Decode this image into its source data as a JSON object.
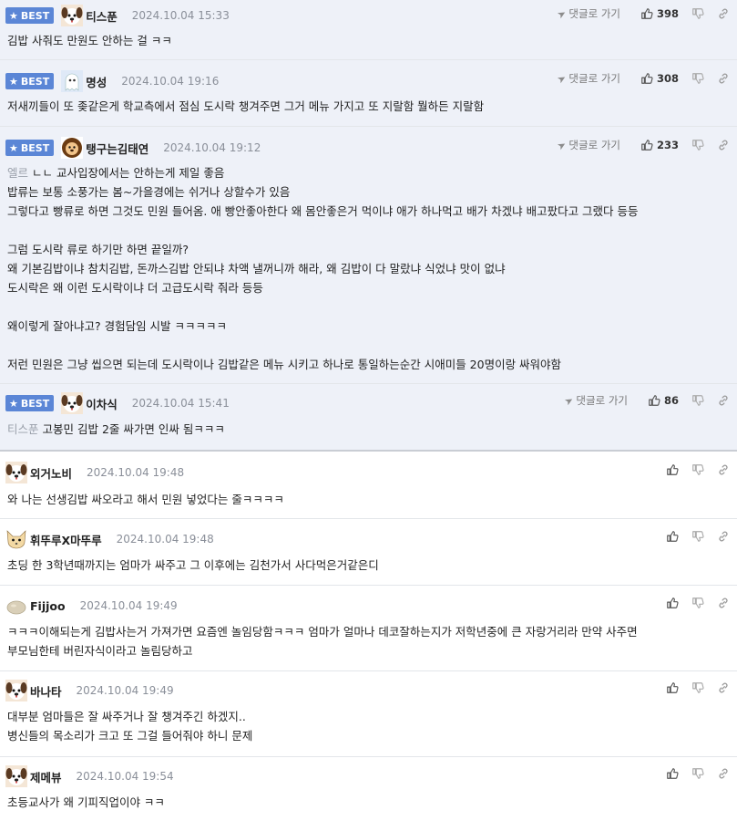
{
  "best_label": "BEST",
  "reply_label": "댓글로 가기",
  "comments": [
    {
      "nick": "티스푼",
      "date": "2024.10.04 15:33",
      "likes": "398",
      "mention": "",
      "text": "김밥 사줘도 만원도 안하는 걸 ㅋㅋ",
      "avatar": "dog-avatar"
    },
    {
      "nick": "명성",
      "date": "2024.10.04 19:16",
      "likes": "308",
      "mention": "",
      "text": "저새끼들이 또 좆같은게 학교측에서 점심 도시락 챙겨주면 그거 메뉴 가지고 또 지랄함 뭘하든 지랄함",
      "avatar": "ghost-avatar"
    },
    {
      "nick": "탱구는김태연",
      "date": "2024.10.04 19:12",
      "likes": "233",
      "mention": "엘르",
      "text": "ㄴㄴ 교사입장에서는 안하는게 제일 좋음\n밥류는 보통 소풍가는 봄~가을경에는 쉬거나 상할수가 있음\n그렇다고 빵류로 하면 그것도 민원 들어옴. 애 빵안좋아한다 왜 몸안좋은거 먹이냐 애가 하나먹고 배가 차겠냐 배고팠다고 그랬다 등등\n\n그럼 도시락 류로 하기만 하면 끝일까?\n왜 기본김밥이냐 참치김밥, 돈까스김밥 안되냐 차액 낼꺼니까 해라, 왜 김밥이 다 말랐냐 식었냐 맛이 없냐\n도시락은 왜 이런 도시락이냐 더 고급도시락 줘라 등등\n\n왜이렇게 잘아냐고? 경험담임 시발 ㅋㅋㅋㅋㅋ\n\n저런 민원은 그냥 씹으면 되는데 도시락이나 김밥같은 메뉴 시키고 하나로 통일하는순간 시애미들 20명이랑 싸워야함",
      "avatar": "lion-avatar"
    },
    {
      "nick": "이차식",
      "date": "2024.10.04 15:41",
      "likes": "86",
      "mention": "티스푼",
      "text": "고봉민 김밥 2줄 싸가면 인싸 됨ㅋㅋㅋ",
      "avatar": "dog-avatar"
    },
    {
      "nick": "외거노비",
      "date": "2024.10.04 19:48",
      "text": "와 나는 선생김밥 싸오라고 해서 민원 넣었다는 줄ㅋㅋㅋㅋ",
      "avatar": "dog-avatar"
    },
    {
      "nick": "휘뚜루X마뚜루",
      "date": "2024.10.04 19:48",
      "text": "초딩 한 3학년때까지는 엄마가 싸주고 그 이후에는 김천가서 사다먹은거같은디",
      "avatar": "cat-avatar"
    },
    {
      "nick": "Fijjoo",
      "date": "2024.10.04 19:49",
      "text": "ㅋㅋㅋ이해되는게 김밥사는거 가져가면 요즘엔 놀임당함ㅋㅋㅋ 엄마가 얼마나 데코잘하는지가 저학년중에 큰 자랑거리라 만약 사주면\n부모님한테 버린자식이라고 놀림당하고",
      "avatar": "stone-avatar"
    },
    {
      "nick": "바나타",
      "date": "2024.10.04 19:49",
      "text": "대부분 엄마들은 잘 싸주거나 잘 챙겨주긴 하겠지..\n병신들의 목소리가 크고 또 그걸 들어줘야 하니 문제",
      "avatar": "dog-avatar"
    },
    {
      "nick": "제메뷰",
      "date": "2024.10.04 19:54",
      "text": "초등교사가 왜 기피직업이야 ㅋㅋ",
      "avatar": "dog-avatar"
    }
  ]
}
